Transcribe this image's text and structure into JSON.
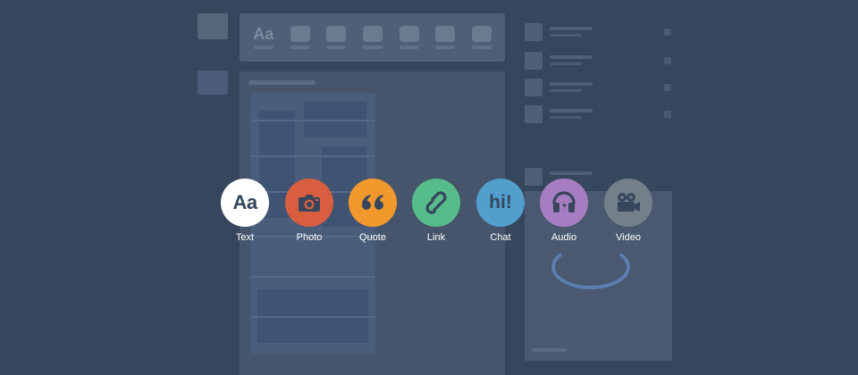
{
  "overlay": {
    "post_types": [
      {
        "id": "text",
        "label": "Text",
        "icon": "text-aa-icon",
        "glyph": "Aa",
        "color": "#ffffff"
      },
      {
        "id": "photo",
        "label": "Photo",
        "icon": "camera-icon",
        "color": "#d95e40"
      },
      {
        "id": "quote",
        "label": "Quote",
        "icon": "quote-marks-icon",
        "color": "#f2992e"
      },
      {
        "id": "link",
        "label": "Link",
        "icon": "link-chain-icon",
        "color": "#56bc8a"
      },
      {
        "id": "chat",
        "label": "Chat",
        "icon": "chat-hi-icon",
        "glyph": "hi!",
        "color": "#529ecc"
      },
      {
        "id": "audio",
        "label": "Audio",
        "icon": "headphones-icon",
        "color": "#a77dc2"
      },
      {
        "id": "video",
        "label": "Video",
        "icon": "video-camera-icon",
        "color": "#748089"
      }
    ]
  },
  "colors": {
    "page_background": "#36465d",
    "icon_foreground": "#36465d",
    "label_text": "#ffffff"
  }
}
